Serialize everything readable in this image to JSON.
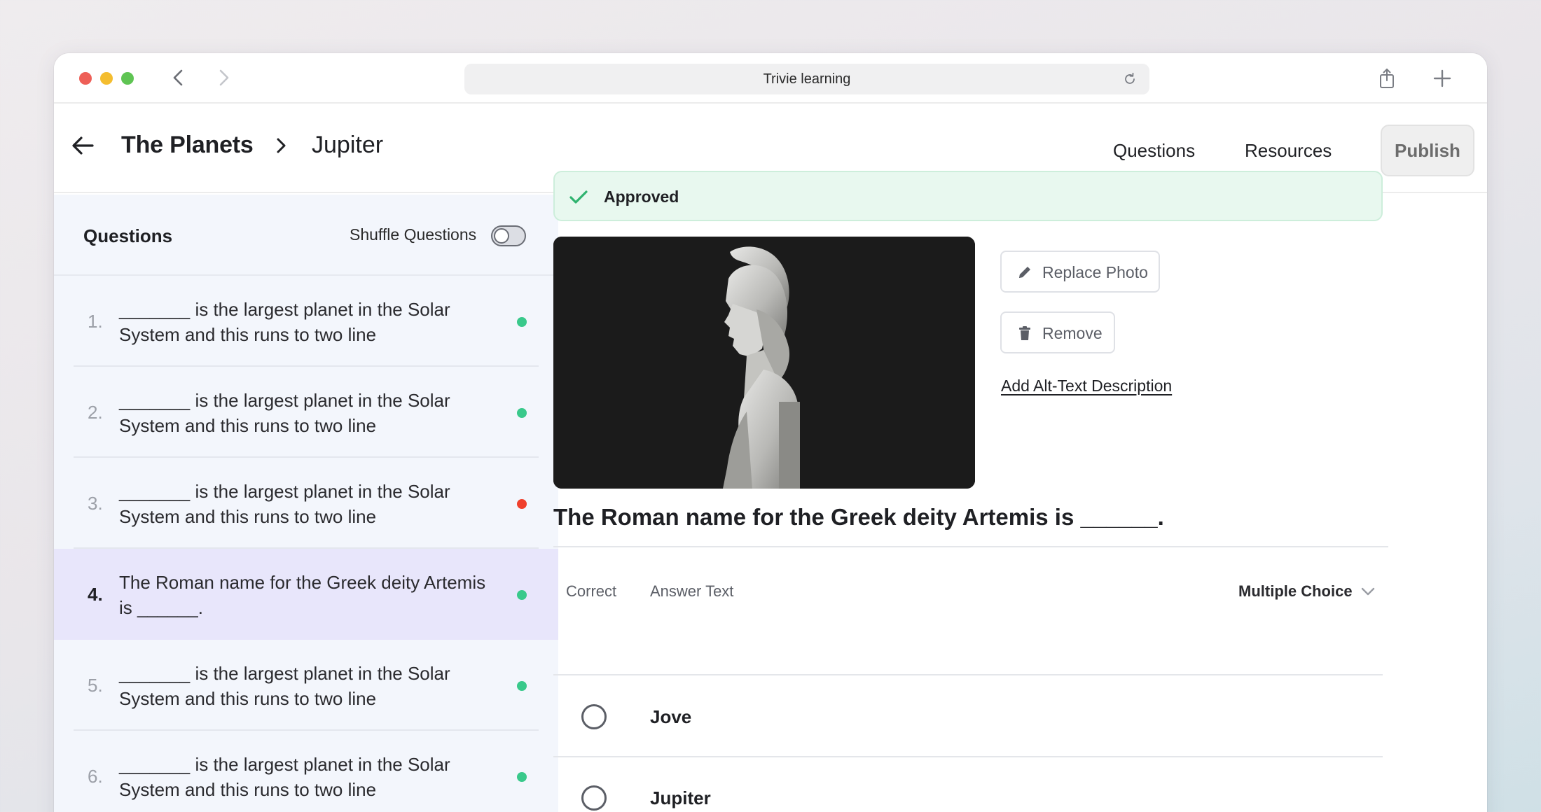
{
  "browser": {
    "url_title": "Trivie learning"
  },
  "header": {
    "breadcrumb_parent": "The Planets",
    "breadcrumb_current": "Jupiter",
    "tabs": [
      {
        "label": "Questions",
        "active": true
      },
      {
        "label": "Resources",
        "active": false
      }
    ],
    "publish_label": "Publish"
  },
  "sidebar": {
    "title": "Questions",
    "shuffle_label": "Shuffle Questions",
    "shuffle_on": false,
    "items": [
      {
        "number": "1.",
        "text": "_______ is the largest planet in the Solar System and this runs to two line",
        "status": "green",
        "active": false
      },
      {
        "number": "2.",
        "text": "_______ is the largest planet in the Solar System and this runs to two line",
        "status": "green",
        "active": false
      },
      {
        "number": "3.",
        "text": "_______ is the largest planet in the Solar System and this runs to two line",
        "status": "red",
        "active": false
      },
      {
        "number": "4.",
        "text": "The Roman name for the Greek deity Artemis is ______.",
        "status": "green",
        "active": true
      },
      {
        "number": "5.",
        "text": "_______ is the largest planet in the Solar System and this runs to two line",
        "status": "green",
        "active": false
      },
      {
        "number": "6.",
        "text": "_______ is the largest planet in the Solar System and this runs to two line",
        "status": "green",
        "active": false
      }
    ]
  },
  "main": {
    "status_banner": "Approved",
    "replace_photo_label": "Replace Photo",
    "remove_label": "Remove",
    "alt_text_link": "Add Alt-Text Description",
    "question_title": "The Roman name for the Greek deity Artemis is ______.",
    "columns": {
      "correct": "Correct",
      "answer": "Answer Text"
    },
    "question_type": "Multiple Choice",
    "answers": [
      {
        "text": "Jove",
        "correct": false
      },
      {
        "text": "Jupiter",
        "correct": false
      }
    ]
  },
  "colors": {
    "accent": "#2d5bd3",
    "status_green": "#39c98b",
    "status_red": "#f0402c",
    "approved_bg": "#e8f8ef",
    "active_row": "#e8e6fb"
  }
}
